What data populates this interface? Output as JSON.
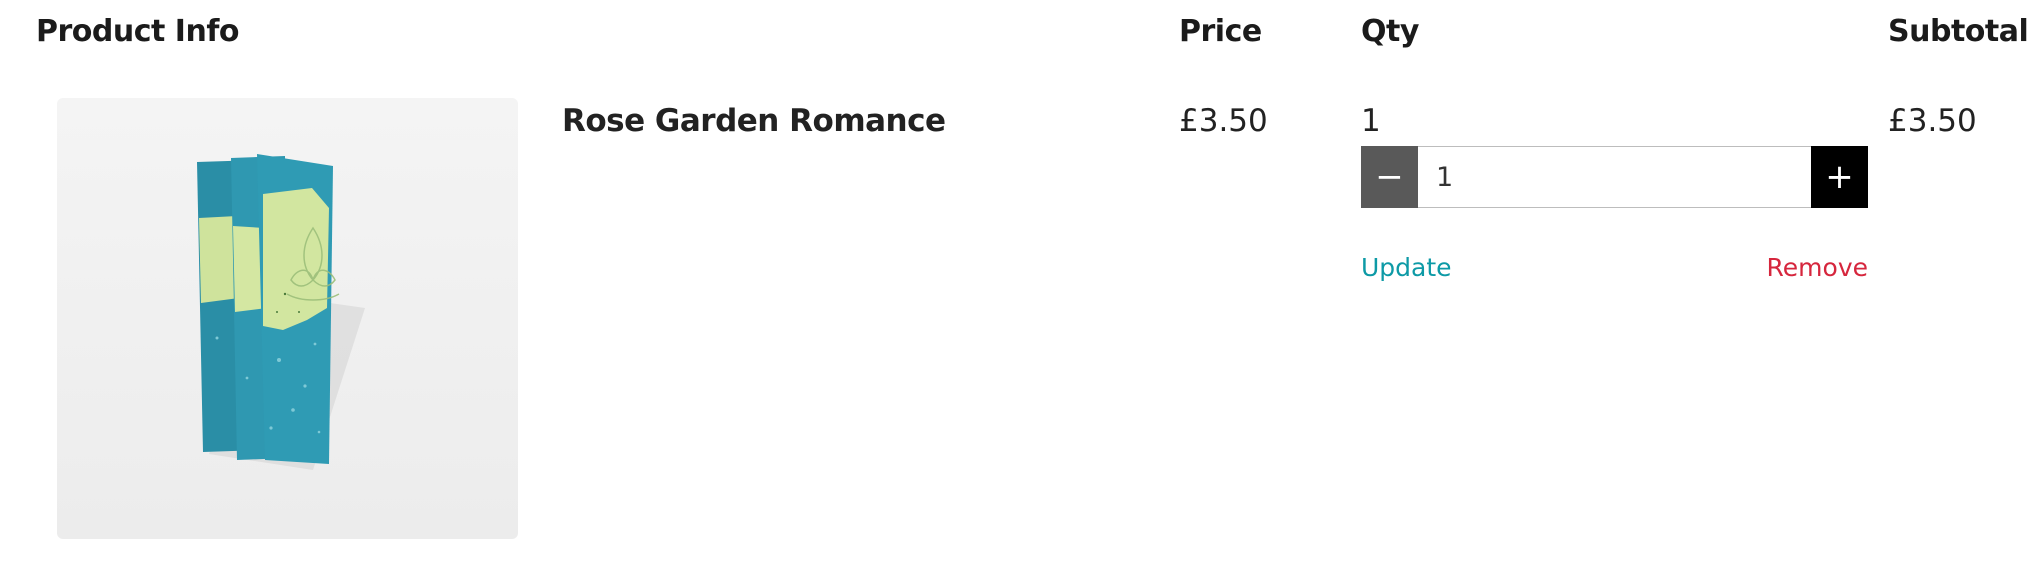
{
  "cart_table": {
    "headers": {
      "product_info": "Product Info",
      "price": "Price",
      "qty": "Qty",
      "subtotal": "Subtotal"
    },
    "items": [
      {
        "name": "Rose Garden Romance",
        "image_alt": "Rose Garden Romance",
        "price": "£3.50",
        "qty_display": "1",
        "qty_input_value": "1",
        "decrement_symbol": "−",
        "increment_symbol": "+",
        "subtotal": "£3.50",
        "update_label": "Update",
        "remove_label": "Remove"
      }
    ]
  },
  "icons": {
    "decrement": "minus-icon",
    "increment": "plus-icon"
  },
  "colors": {
    "update_link": "#0d9aa6",
    "remove_link": "#d6263d",
    "minus_button": "#595959",
    "plus_button": "#000000",
    "wax_teal": "#2f9bb4",
    "wax_green": "#d2e6a0"
  }
}
